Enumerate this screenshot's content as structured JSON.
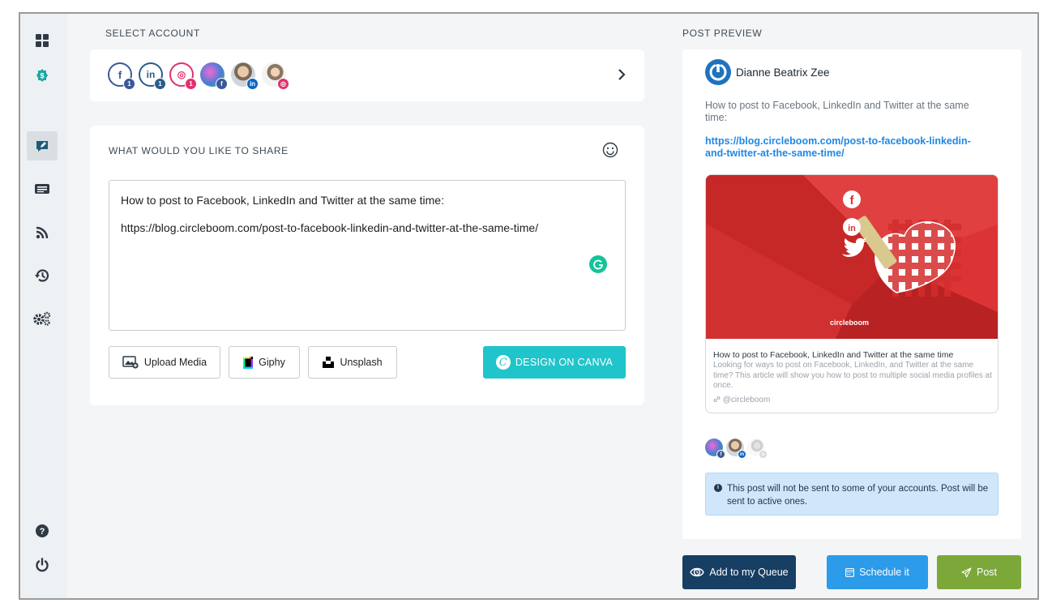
{
  "sidebar": {
    "items": [
      {
        "name": "dashboard-icon"
      },
      {
        "name": "billing-icon"
      },
      {
        "name": "compose-icon",
        "active": true
      },
      {
        "name": "queue-icon"
      },
      {
        "name": "rss-icon"
      },
      {
        "name": "history-icon"
      },
      {
        "name": "settings-icon"
      },
      {
        "name": "help-icon"
      },
      {
        "name": "logout-icon"
      }
    ]
  },
  "select_account": {
    "label": "SELECT ACCOUNT",
    "accounts": [
      {
        "type": "facebook-page",
        "glyph": "f",
        "badge": "1",
        "color": "#3b5998"
      },
      {
        "type": "linkedin-page",
        "glyph": "in",
        "badge": "1",
        "color": "#2b5d8c"
      },
      {
        "type": "instagram",
        "glyph": "◎",
        "badge": "1",
        "color": "#e1306c"
      },
      {
        "type": "facebook-profile",
        "badge_icon": "f",
        "color": "#3b5998"
      },
      {
        "type": "linkedin-profile",
        "badge_icon": "in",
        "color": "#0a66c2"
      },
      {
        "type": "instagram-profile",
        "badge_icon": "◎",
        "color": "#e1306c"
      }
    ]
  },
  "composer": {
    "title": "WHAT WOULD YOU LIKE TO SHARE",
    "line1": "How to post to Facebook, LinkedIn and Twitter at the same time:",
    "line2": "https://blog.circleboom.com/post-to-facebook-linkedin-and-twitter-at-the-same-time/",
    "upload_label": "Upload Media",
    "giphy_label": "Giphy",
    "unsplash_label": "Unsplash",
    "canva_label": "DESIGN ON CANVA",
    "canva_logo": "C"
  },
  "preview": {
    "label": "POST PREVIEW",
    "user_name": "Dianne Beatrix Zee",
    "text": "How to post to Facebook, LinkedIn and Twitter at the same time:",
    "link": "https://blog.circleboom.com/post-to-facebook-linkedin-and-twitter-at-the-same-time/",
    "card_title": "How to post to Facebook, LinkedIn and Twitter at the same time",
    "card_desc": "Looking for ways to post on Facebook, LinkedIn, and Twitter at the same time? This article will show you how to post to multiple social media profiles at once.",
    "card_domain": "@circleboom",
    "image_brand": "circleboom",
    "notice_icon": "i",
    "notice": "This post will not be sent to some of your accounts. Post will be sent to active ones."
  },
  "actions": {
    "queue_label": "Add to my Queue",
    "schedule_label": "Schedule it",
    "post_label": "Post",
    "colors": {
      "queue": "#173e63",
      "schedule": "#2b9bea",
      "post": "#7ca83a"
    }
  }
}
